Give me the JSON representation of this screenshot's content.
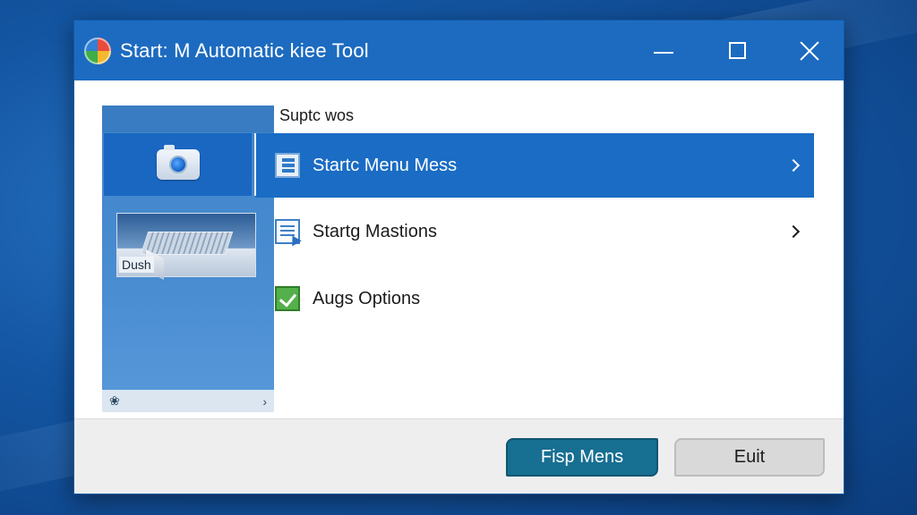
{
  "window": {
    "title": "Start: M Automatic kiee Tool"
  },
  "sidebar": {
    "image_caption": "Dush",
    "footer_icon": "leaf-icon",
    "footer_chevron": "›"
  },
  "main": {
    "section_label": "Suptc wos",
    "items": [
      {
        "label": "Startc Menu Mess",
        "icon": "start-menu-icon",
        "selected": true,
        "has_chevron": true
      },
      {
        "label": "Startg Mastions",
        "icon": "document-icon",
        "selected": false,
        "has_chevron": true
      },
      {
        "label": "Augs Options",
        "icon": "checkmark-icon",
        "selected": false,
        "has_chevron": false
      }
    ]
  },
  "buttons": {
    "primary_label": "Fisp Mens",
    "secondary_label": "Euit"
  },
  "colors": {
    "titlebar": "#1d6bc0",
    "selection": "#1a6cc4",
    "primary_button": "#176f92",
    "sidebar": "#4a8dd1"
  }
}
